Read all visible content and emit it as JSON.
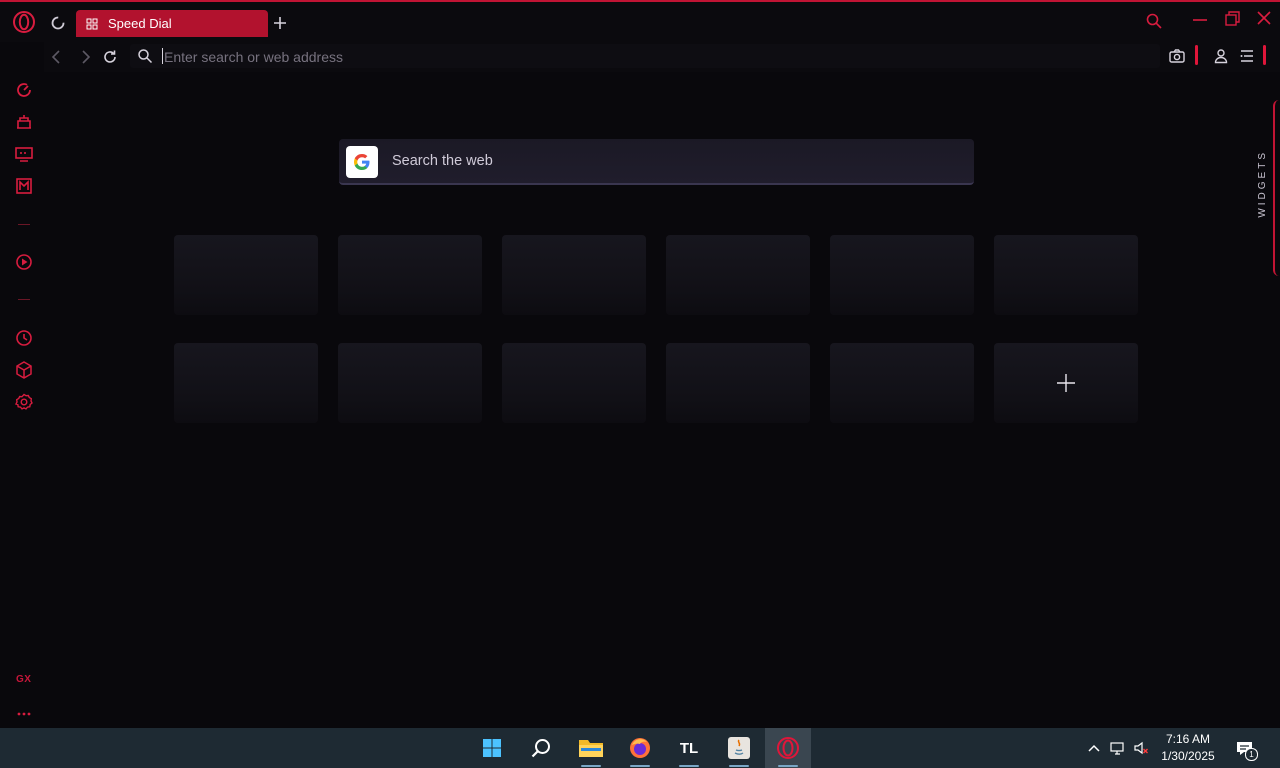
{
  "window": {
    "tab_title": "Speed Dial",
    "accent": "#c11434"
  },
  "address_bar": {
    "placeholder": "Enter search or web address",
    "value": ""
  },
  "speed_dial": {
    "search_placeholder": "Search the web",
    "search_engine_icon": "google-g-icon",
    "tile_rows": 2,
    "tiles_per_row": 6,
    "add_tile_icon": "plus-icon"
  },
  "sidebar": {
    "items": [
      {
        "name": "speed-dial-icon"
      },
      {
        "name": "shopping-corner-icon"
      },
      {
        "name": "twitch-icon"
      },
      {
        "name": "messenger-icon"
      },
      {
        "name": "player-icon"
      },
      {
        "name": "history-icon"
      },
      {
        "name": "extensions-icon"
      },
      {
        "name": "settings-icon"
      }
    ],
    "gx_label": "GX"
  },
  "widgets": {
    "label": "WIDGETS"
  },
  "taskbar": {
    "apps": [
      {
        "name": "windows-start-icon"
      },
      {
        "name": "search-icon"
      },
      {
        "name": "file-explorer-icon"
      },
      {
        "name": "firefox-icon"
      },
      {
        "name": "tl-app-icon",
        "label": "TL"
      },
      {
        "name": "java-app-icon"
      },
      {
        "name": "opera-gx-icon"
      }
    ],
    "time": "7:16 AM",
    "date": "1/30/2025",
    "notification_count": "1"
  }
}
